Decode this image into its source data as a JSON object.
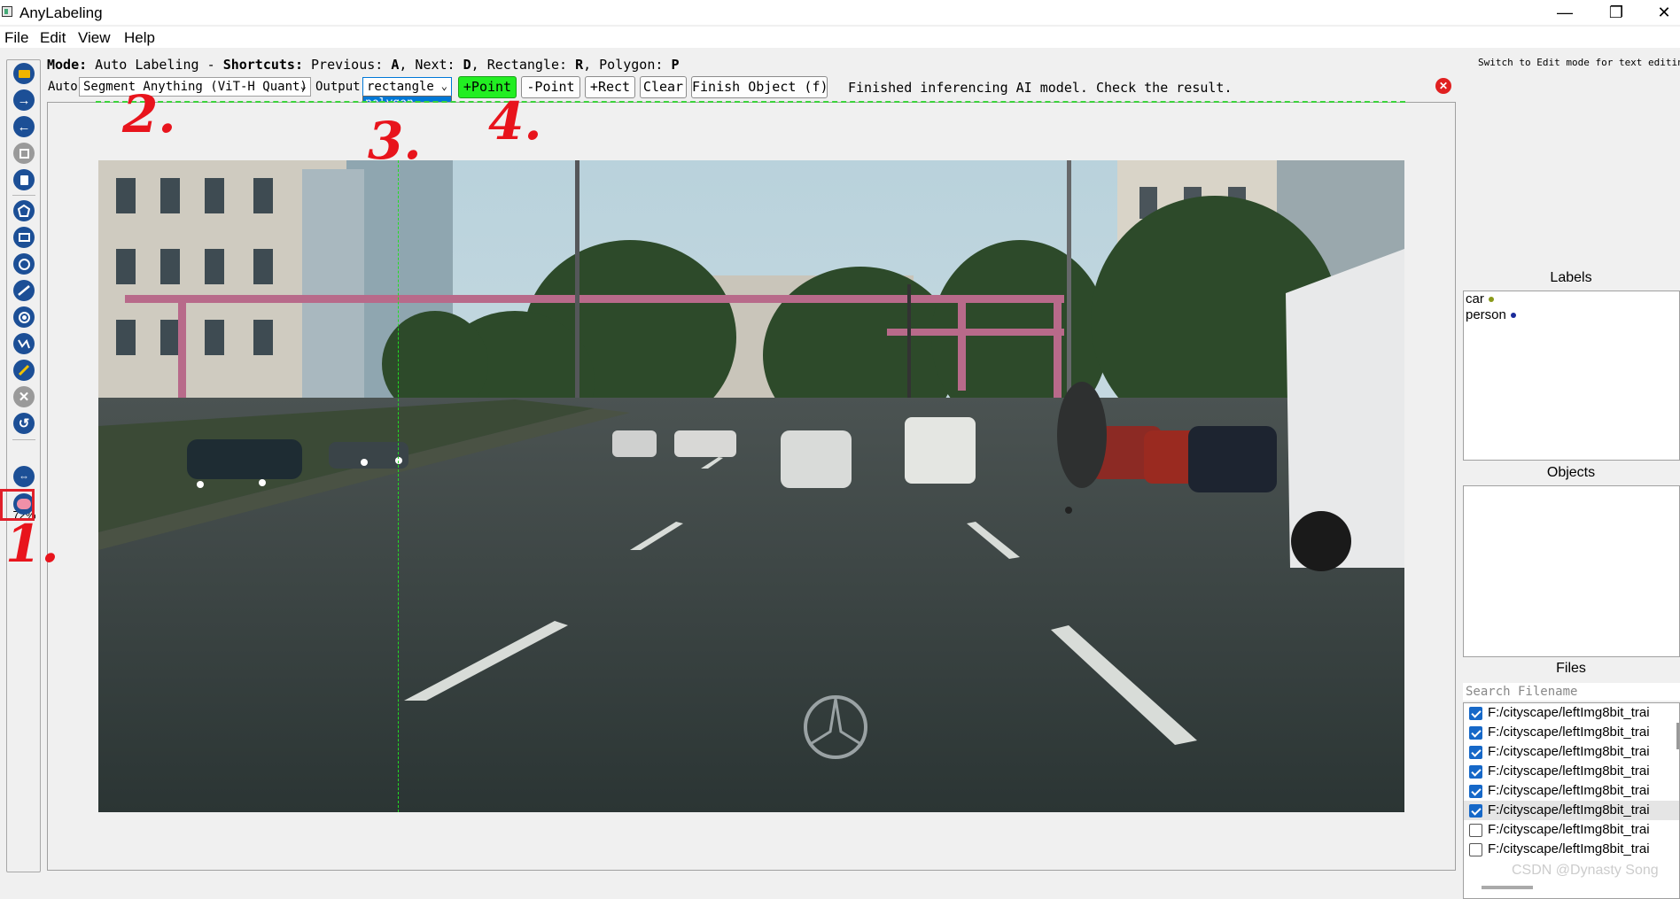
{
  "window": {
    "title": "AnyLabeling",
    "controls": {
      "minimize": "—",
      "maximize": "❐",
      "close": "✕"
    }
  },
  "menu": [
    "File",
    "Edit",
    "View",
    "Help"
  ],
  "info_line": {
    "mode_key": "Mode:",
    "mode_value": " Auto Labeling - ",
    "shortcuts_key": "Shortcuts:",
    "prev": " Previous: ",
    "prev_key": "A",
    "next": ", Next: ",
    "next_key": "D",
    "rect": ", Rectangle: ",
    "rect_key": "R",
    "poly": ", Polygon: ",
    "poly_key": "P"
  },
  "switch_note": "Switch to Edit mode for text editing",
  "ai_toolbar": {
    "auto_label": "Auto",
    "model_value": "Segment Anything (ViT-H Quant)",
    "output_label": "Output",
    "output_value": "rectangle",
    "output_options": [
      "polygon",
      "rectangle"
    ],
    "output_selected_option": "polygon",
    "btn_add_point": "+Point",
    "btn_remove_point": "-Point",
    "btn_add_rect": "+Rect",
    "btn_clear": "Clear",
    "btn_finish": "Finish Object (f)",
    "status": "Finished inferencing AI model. Check the result."
  },
  "left_toolbar": {
    "zoom": "72%",
    "tools": [
      "open-folder-icon",
      "next-image-icon",
      "prev-image-icon",
      "save-icon",
      "delete-icon",
      "create-polygon-icon",
      "create-rectangle-icon",
      "create-circle-icon",
      "create-line-icon",
      "create-point-icon",
      "create-linestrip-icon",
      "edit-icon",
      "delete-shape-icon",
      "undo-icon",
      "fit-width-icon",
      "auto-labeling-icon"
    ]
  },
  "annotations": [
    "1.",
    "2.",
    "3.",
    "4."
  ],
  "right_panel": {
    "labels_title": "Labels",
    "labels": [
      {
        "name": "car",
        "color": "#8a9a1a"
      },
      {
        "name": "person",
        "color": "#1a2a9a"
      }
    ],
    "objects_title": "Objects",
    "files_title": "Files",
    "search_placeholder": "Search Filename",
    "files": [
      {
        "name": "F:/cityscape/leftImg8bit_trai",
        "checked": true,
        "selected": false
      },
      {
        "name": "F:/cityscape/leftImg8bit_trai",
        "checked": true,
        "selected": false
      },
      {
        "name": "F:/cityscape/leftImg8bit_trai",
        "checked": true,
        "selected": false
      },
      {
        "name": "F:/cityscape/leftImg8bit_trai",
        "checked": true,
        "selected": false
      },
      {
        "name": "F:/cityscape/leftImg8bit_trai",
        "checked": true,
        "selected": false
      },
      {
        "name": "F:/cityscape/leftImg8bit_trai",
        "checked": true,
        "selected": true
      },
      {
        "name": "F:/cityscape/leftImg8bit_trai",
        "checked": false,
        "selected": false
      },
      {
        "name": "F:/cityscape/leftImg8bit_trai",
        "checked": false,
        "selected": false
      }
    ]
  },
  "watermark": "CSDN @Dynasty Song",
  "colors": {
    "accent": "#1c4f96",
    "point_button": "#22ee22",
    "annotation": "#e8141c",
    "highlight_box": "#e0202a"
  }
}
